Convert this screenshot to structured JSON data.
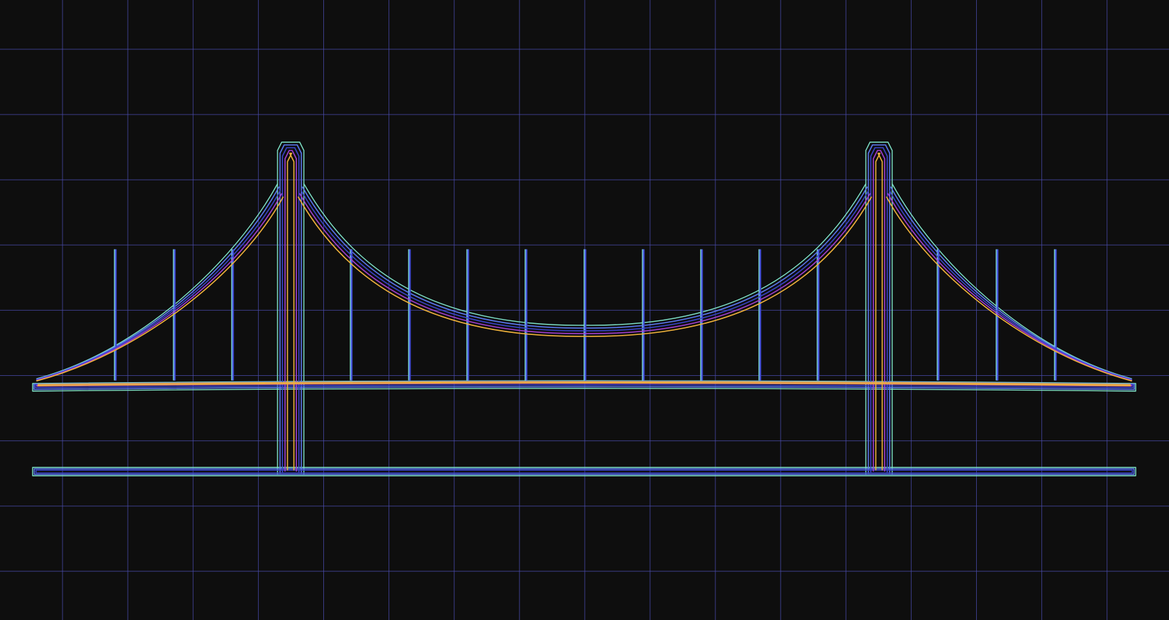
{
  "view": {
    "background": "#0e0e0e",
    "grid_color": "#4a4cae",
    "grid_visible": true
  },
  "drawing": {
    "subject": "suspension-bridge",
    "contour_layers": [
      {
        "name": "outer-contour",
        "color": "#7fe3c8"
      },
      {
        "name": "second-contour",
        "color": "#5b78f0"
      },
      {
        "name": "third-contour",
        "color": "#3a44c8"
      },
      {
        "name": "inner-contour",
        "color": "#a23fd0"
      },
      {
        "name": "core-contour",
        "color": "#f0b23a"
      }
    ]
  }
}
